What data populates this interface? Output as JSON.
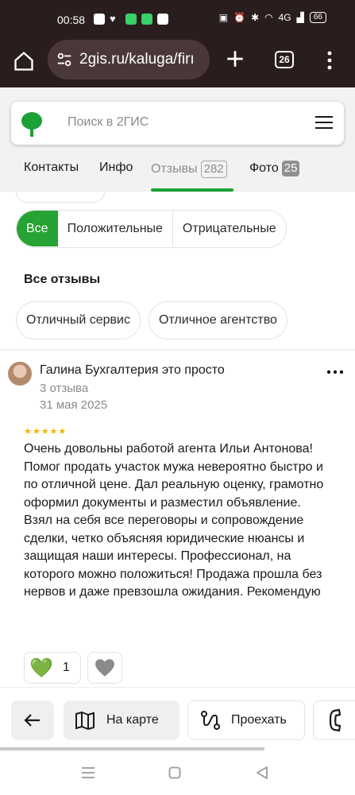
{
  "status_bar": {
    "time": "00:58",
    "network": "4G",
    "battery": "66"
  },
  "browser": {
    "url": "2gis.ru/kaluga/firı",
    "tab_count": "26"
  },
  "search": {
    "placeholder": "Поиск в 2ГИС"
  },
  "nav": {
    "tabs": [
      {
        "label": "Контакты"
      },
      {
        "label": "Инфо"
      },
      {
        "label": "Отзывы",
        "count": "282",
        "active": true
      },
      {
        "label": "Фото",
        "count": "25"
      }
    ]
  },
  "filters": {
    "items": [
      "Все",
      "Положительные",
      "Отрицательные"
    ],
    "selected": "Все"
  },
  "section": {
    "title": "Все отзывы",
    "tags": [
      "Отличный сервис",
      "Отличное агентство"
    ]
  },
  "review": {
    "author": "Галина Бухгалтерия это просто",
    "reviews_count": "3 отзыва",
    "date": "31 мая 2025",
    "rating": 5,
    "stars": "★★★★★",
    "text": "Очень довольны работой агента Ильи Антонова! Помог продать участок мужа невероятно быстро и по отличной цене. Дал реальную оценку, грамотно оформил документы и разместил объявление. Взял на себя все переговоры и сопровождение сделки, четко объясняя юридические нюансы и защищая наши интересы. Профессионал, на которого можно положиться! Продажа прошла без нервов и даже превзошла ожидания. Рекомендую",
    "likes": "1"
  },
  "bottom_bar": {
    "map_label": "На карте",
    "route_label": "Проехать"
  },
  "colors": {
    "accent_green": "#26a332",
    "browser_dark": "#2a1d1d",
    "star_yellow": "#f5b400"
  }
}
